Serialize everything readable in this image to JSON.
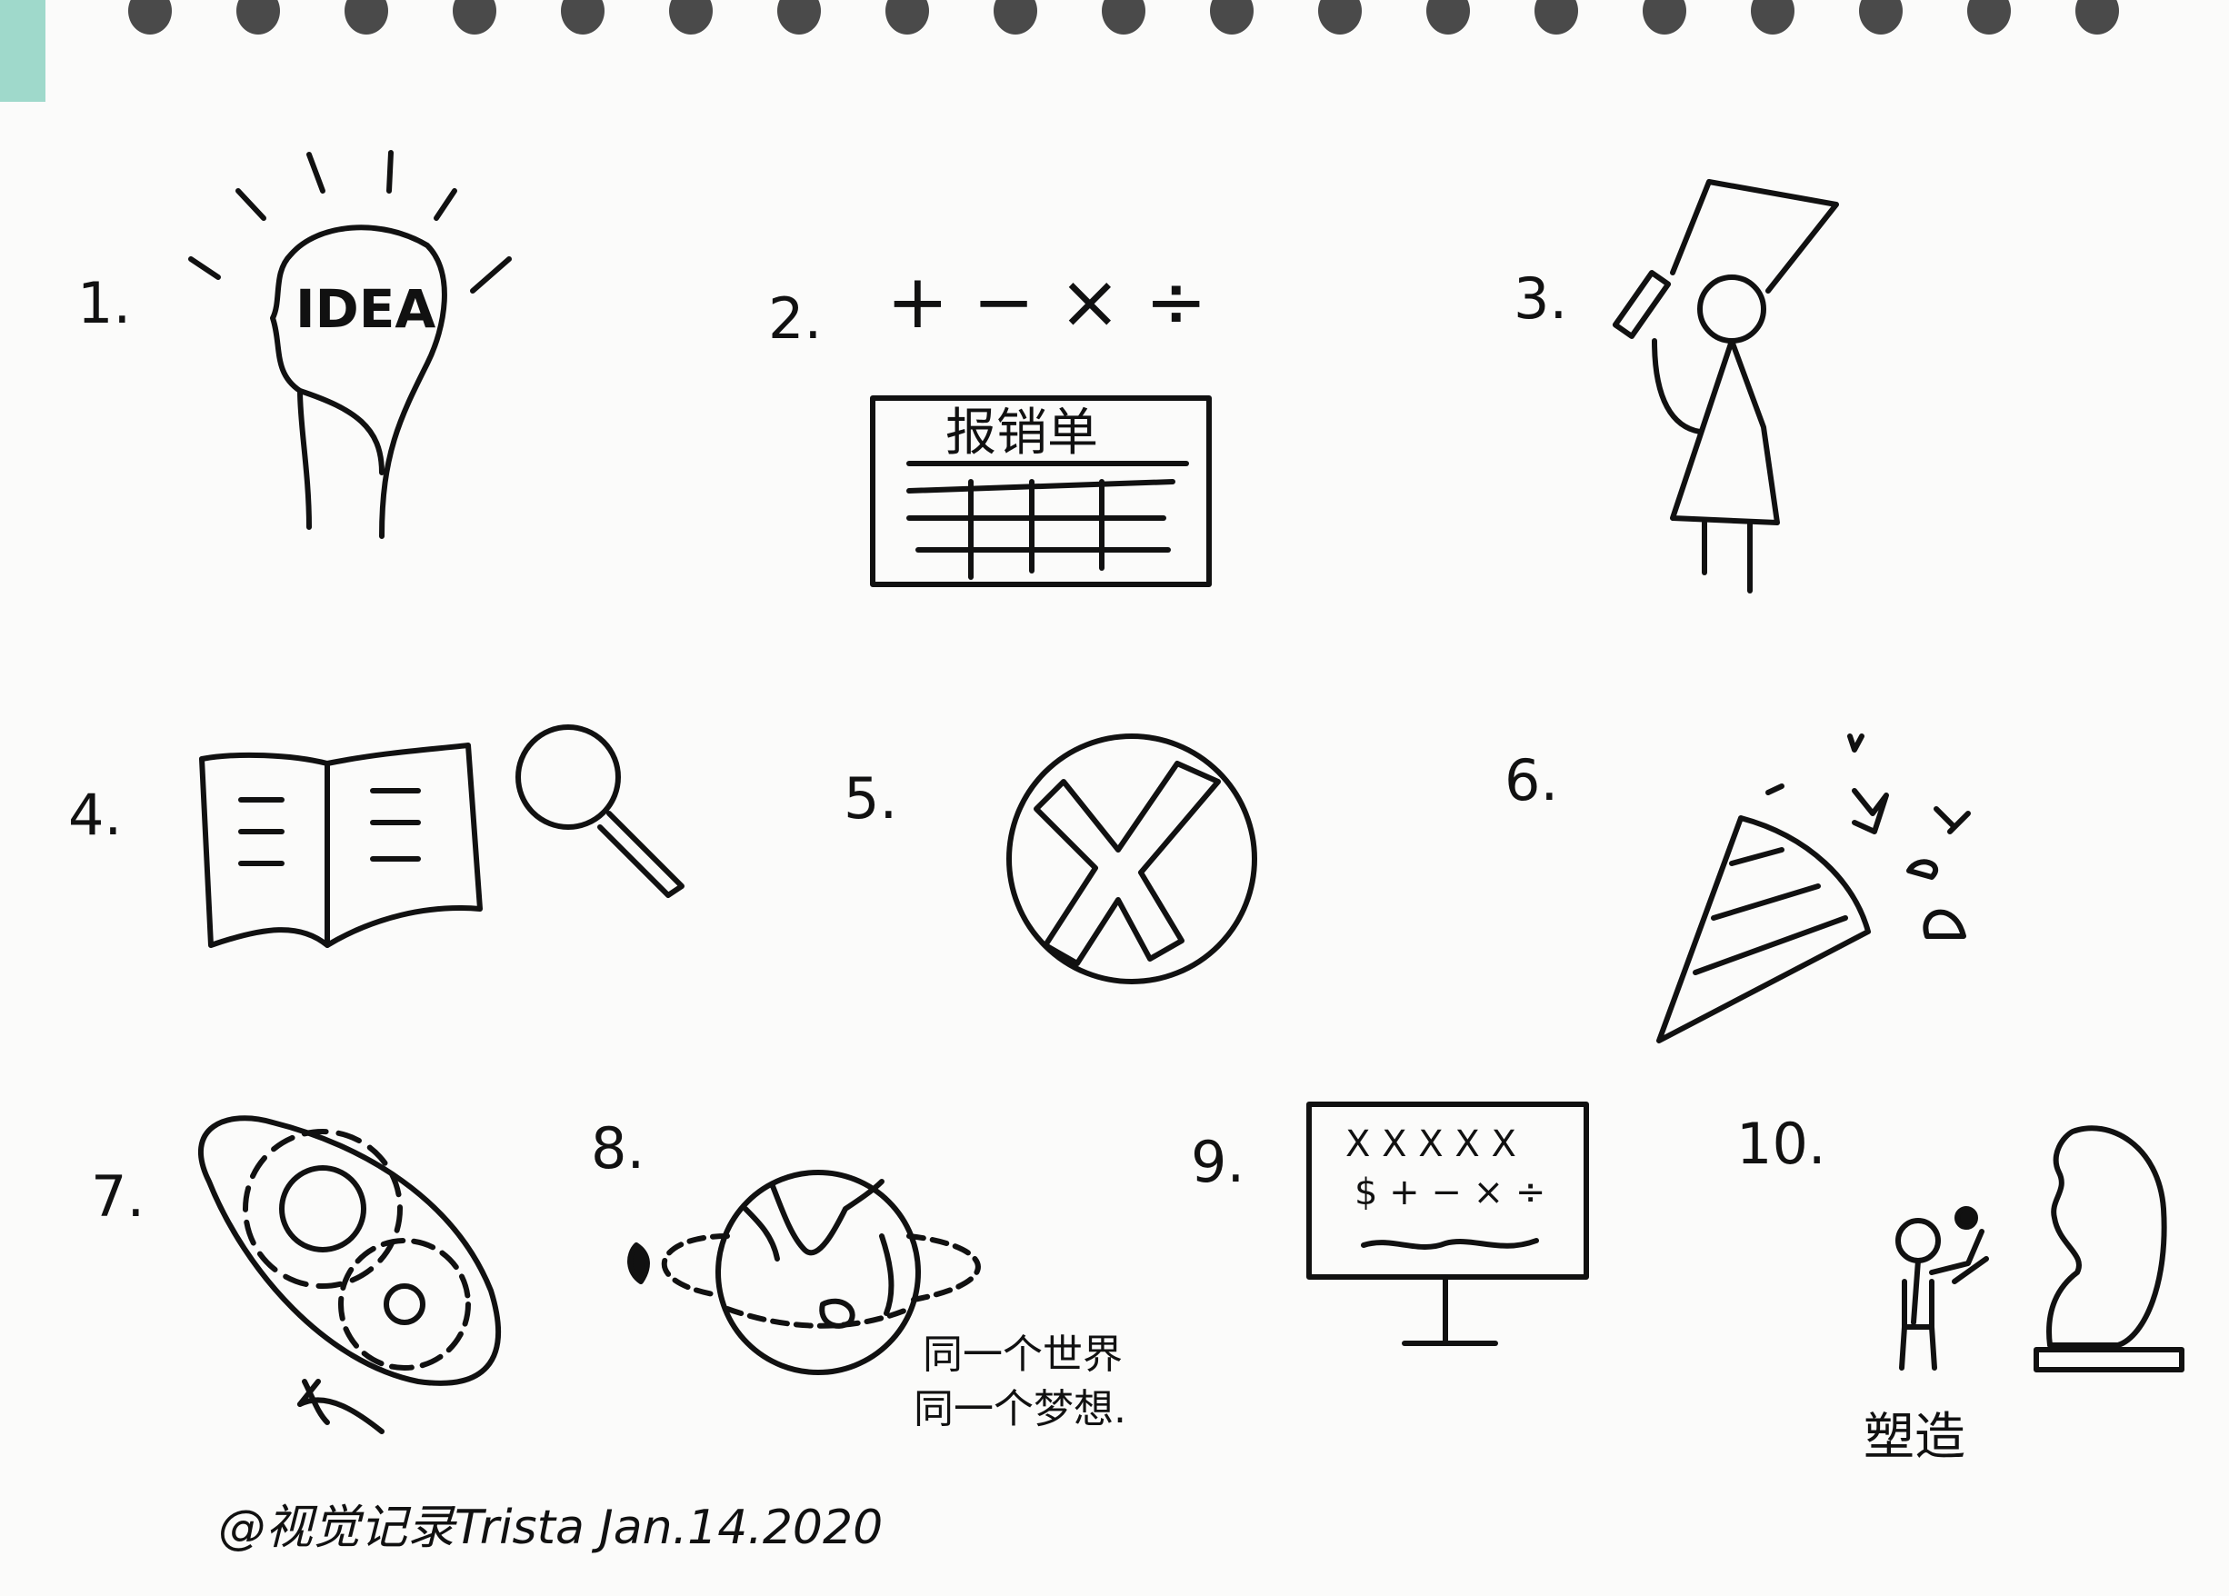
{
  "colors": {
    "paper": "#fbfbfa",
    "ink": "#111111",
    "tab": "#9fd9cb",
    "binding": "#4a4a4a"
  },
  "sketches": [
    {
      "number": "1.",
      "icon": "lightbulb-head-icon",
      "text": "IDEA"
    },
    {
      "number": "2.",
      "icon": "expense-form-icon",
      "operators": "+ − × ÷",
      "form_title": "报销单"
    },
    {
      "number": "3.",
      "icon": "person-with-tall-hat-icon"
    },
    {
      "number": "4.",
      "icon": "book-magnifier-icon"
    },
    {
      "number": "5.",
      "icon": "x-circle-icon"
    },
    {
      "number": "6.",
      "icon": "party-popper-icon"
    },
    {
      "number": "7.",
      "icon": "gears-rotation-icon"
    },
    {
      "number": "8.",
      "icon": "globe-orbit-icon",
      "caption_line1": "同一个世界",
      "caption_line2": "同一个梦想."
    },
    {
      "number": "9.",
      "icon": "monitor-formula-icon",
      "screen_line1": "X X  X  X X",
      "screen_line2": "$ + − × ÷"
    },
    {
      "number": "10.",
      "icon": "sculptor-statue-icon",
      "caption": "塑造"
    }
  ],
  "signature": "@视觉记录Trista  Jan.14.2020"
}
